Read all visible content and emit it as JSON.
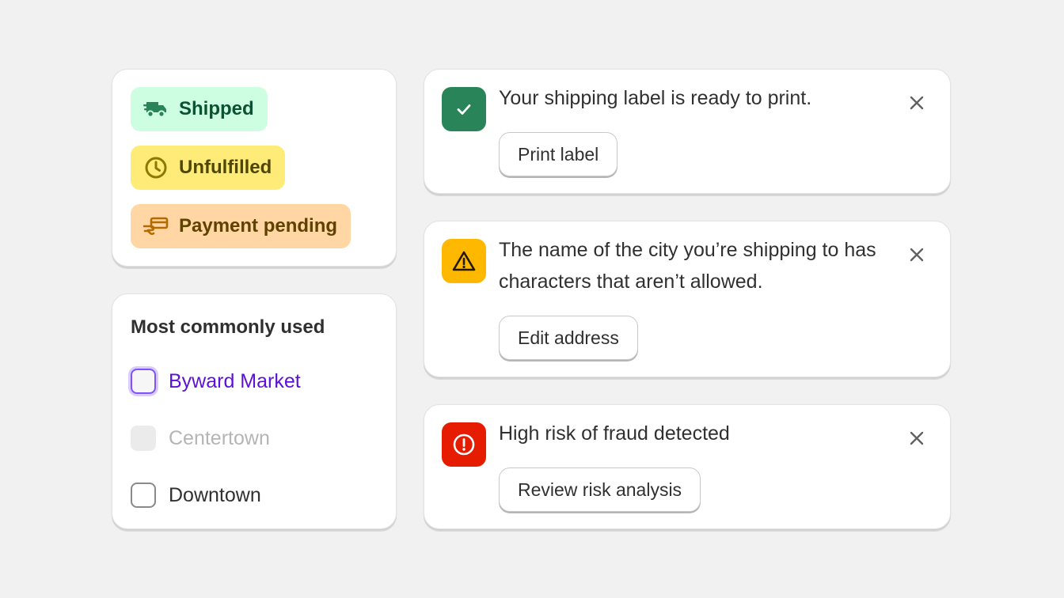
{
  "badges": [
    {
      "label": "Shipped",
      "icon": "delivery-truck-icon",
      "bg": "#cdfee1",
      "color": "#0c5132"
    },
    {
      "label": "Unfulfilled",
      "icon": "clock-icon",
      "bg": "#ffeb78",
      "color": "#4f4700"
    },
    {
      "label": "Payment pending",
      "icon": "hand-card-icon",
      "bg": "#ffd6a4",
      "color": "#5e4200"
    }
  ],
  "location_list": {
    "title": "Most commonly used",
    "items": [
      {
        "label": "Byward Market",
        "state": "focused"
      },
      {
        "label": "Centertown",
        "state": "disabled"
      },
      {
        "label": "Downtown",
        "state": "default"
      }
    ]
  },
  "banners": [
    {
      "tone": "success",
      "icon": "checkmark-icon",
      "message": "Your shipping label is ready to print.",
      "action": "Print label",
      "accent": "#29845a"
    },
    {
      "tone": "warning",
      "icon": "alert-triangle-icon",
      "message": "The name of the city you’re shipping to has characters that aren’t allowed.",
      "action": "Edit address",
      "accent": "#ffb800"
    },
    {
      "tone": "critical",
      "icon": "alert-circle-icon",
      "message": "High risk of fraud detected",
      "action": "Review risk analysis",
      "accent": "#e51c00"
    }
  ]
}
